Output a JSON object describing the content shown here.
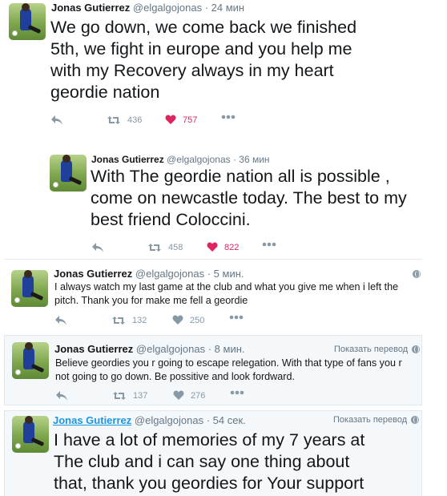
{
  "tweets": [
    {
      "name": "Jonas Gutierrez",
      "handle": "@elgalgojonas",
      "time": "· 24 мин",
      "text": "We go down, we come back we finished\n5th, we fight in europe  and you help me\nwith my Recovery always in my heart\ngeordie nation",
      "retweets": "436",
      "likes": "757",
      "liked": true
    },
    {
      "name": "Jonas Gutierrez",
      "handle": "@elgalgojonas",
      "time": "· 36 мин",
      "text": "With The geordie nation all is possible ,\ncome on newcastle today. The best to my\nbest friend Coloccini.",
      "retweets": "458",
      "likes": "822",
      "liked": true
    },
    {
      "name": "Jonas Gutierrez",
      "handle": "@elgalgojonas",
      "time": "· 5 мин.",
      "text": "I always watch my last game at the club and  what you give me when i left the\npitch. Thank you for make me fell a geordie",
      "retweets": "132",
      "likes": "250",
      "liked": false
    },
    {
      "name": "Jonas Gutierrez",
      "handle": "@elgalgojonas",
      "time": "· 8 мин.",
      "translate": "Показать перевод",
      "text": "Believe geordies you r going to escape relegation. With that type of fans you r\nnot going to go down. Be possitive and look fordward.",
      "retweets": "137",
      "likes": "276",
      "liked": false
    },
    {
      "name": "Jonas Gutierrez",
      "handle": "@elgalgojonas",
      "time": "· 54 сек.",
      "translate": "Показать перевод",
      "text": "I have a lot of memories of my 7 years at\nThe club and i can say one thing about\nthat, thank you geordies for Your support"
    }
  ],
  "colors": {
    "like": "#e0245e",
    "muted": "#8899a6",
    "link": "#1b95e0"
  },
  "icons": [
    "reply-icon",
    "retweet-icon",
    "heart-icon",
    "more-icon",
    "globe-icon"
  ]
}
